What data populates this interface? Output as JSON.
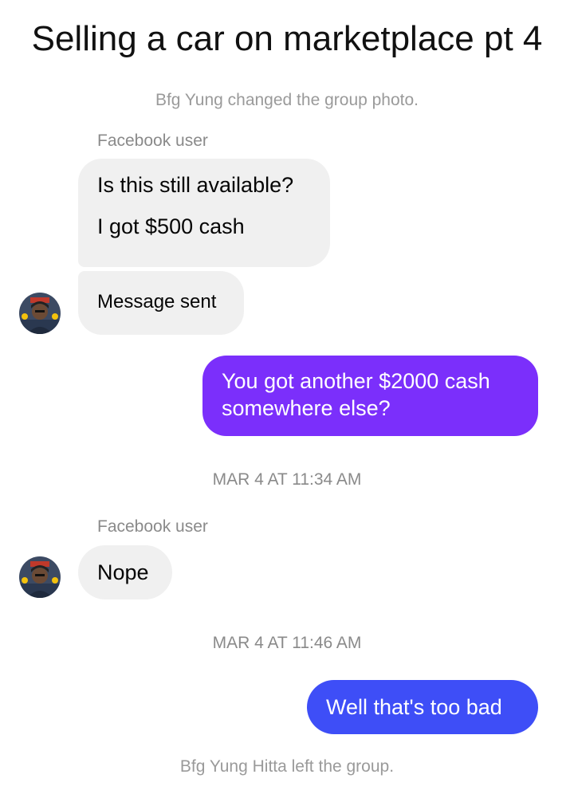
{
  "title": "Selling a car on marketplace pt 4",
  "events": {
    "photo_change": "Bfg Yung changed the group photo.",
    "left_group": "Bfg Yung Hitta left the group."
  },
  "timestamps": {
    "first": "MAR 4 AT 11:34 AM",
    "second": "MAR 4 AT 11:46 AM"
  },
  "sender_name": "Facebook user",
  "messages": {
    "m1_line1": "Is this still available?",
    "m1_line2": "I got $500 cash",
    "m2": "Message sent",
    "m3_line1": "You got another $2000 cash",
    "m3_line2": "somewhere else?",
    "m4": "Nope",
    "m5": "Well that's too bad"
  },
  "colors": {
    "incoming_bubble": "#f0f0f0",
    "outgoing_bubble_purple": "#7b2ffb",
    "outgoing_bubble_blue": "#3e4ef7"
  },
  "icons": {
    "avatar": "profile-photo"
  }
}
